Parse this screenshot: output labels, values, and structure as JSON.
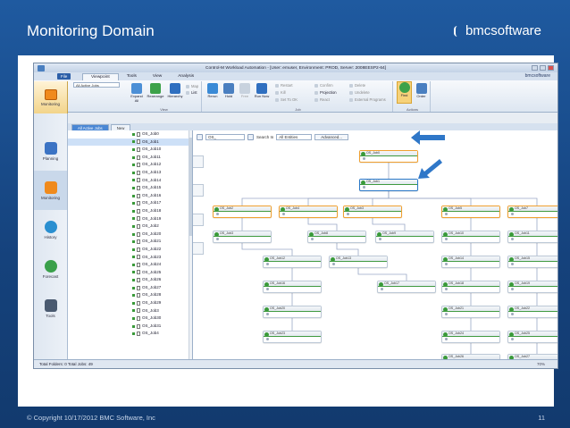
{
  "slide": {
    "title": "Monitoring Domain",
    "logo_text": "bmcsoftware",
    "footer": "© Copyright 10/17/2012 BMC Software, Inc",
    "page_number": "11"
  },
  "app": {
    "window_title": "Control-M Workload Automation - [User: emuser, Environment: PROD, Server: 2008EESP2-64]",
    "file_label": "File",
    "tabs": [
      "Viewpoint",
      "Tools",
      "View",
      "Analysis"
    ],
    "active_tab": "Viewpoint",
    "logo": "bmcsoftware",
    "ribbon": {
      "viewpoint_select": "All Active Jobs",
      "view_group": {
        "expand_all": "Expand All",
        "rearrange": "Rearrange",
        "hierarchy": "Hierarchy",
        "map": "Map",
        "list": "List",
        "label": "View"
      },
      "job_group": {
        "rerun": "Rerun",
        "hold": "Hold",
        "free": "Free",
        "run_now": "Run Now",
        "restart": "Restart",
        "kill": "Kill",
        "set_to_ok": "Set To OK",
        "confirm": "Confirm",
        "projection": "Projection",
        "react": "React",
        "delete": "Delete",
        "undelete": "Undelete",
        "external_programs": "External Programs",
        "label": "Job"
      },
      "actions_group": {
        "find": "Find",
        "order": "Order",
        "label": "Actions"
      }
    },
    "sidenav": [
      {
        "label": "Monitoring"
      },
      {
        "label": "Planning"
      },
      {
        "label": "Monitoring"
      },
      {
        "label": "History"
      },
      {
        "label": "Forecast"
      },
      {
        "label": "Tools"
      }
    ],
    "doc_tabs": [
      "All Active Jobs",
      "New"
    ],
    "tree_items": [
      "OS_Job0",
      "OS_Job1",
      "OS_Job10",
      "OS_Job11",
      "OS_Job12",
      "OS_Job13",
      "OS_Job14",
      "OS_Job15",
      "OS_Job16",
      "OS_Job17",
      "OS_Job18",
      "OS_Job19",
      "OS_Job2",
      "OS_Job20",
      "OS_Job21",
      "OS_Job22",
      "OS_Job23",
      "OS_Job24",
      "OS_Job25",
      "OS_Job26",
      "OS_Job27",
      "OS_Job28",
      "OS_Job29",
      "OS_Job3",
      "OS_Job30",
      "OS_Job31",
      "OS_Job4"
    ],
    "selected_tree_item": "OS_Job1",
    "search": {
      "value": "OS_",
      "search_in_label": "Search In",
      "search_in_value": "All Entities",
      "advanced_button": "Advanced..."
    },
    "status": {
      "left": "Total Folders: 0    Total Jobs: 49",
      "zoom": "70%"
    },
    "graph_nodes": [
      {
        "id": "n1",
        "label": "OS_Job0",
        "style": "orange"
      },
      {
        "id": "n2",
        "label": "OS_Job1",
        "style": "blue"
      },
      {
        "id": "n3",
        "label": "OS_Job2",
        "style": "orange"
      },
      {
        "id": "n4",
        "label": "OS_Job4",
        "style": "orange"
      },
      {
        "id": "n5",
        "label": "OS_Job3",
        "style": "orange"
      },
      {
        "id": "n6",
        "label": "OS_Job5",
        "style": "orange"
      },
      {
        "id": "n7",
        "label": "OS_Job7",
        "style": "orange"
      },
      {
        "id": "n8",
        "label": "OS_Job3",
        "style": "plain"
      },
      {
        "id": "n9",
        "label": "OS_Job8",
        "style": "plain"
      },
      {
        "id": "n10",
        "label": "OS_Job9",
        "style": "plain"
      },
      {
        "id": "n11",
        "label": "OS_Job10",
        "style": "plain"
      },
      {
        "id": "n12",
        "label": "OS_Job11",
        "style": "plain"
      },
      {
        "id": "n13",
        "label": "OS_Job12",
        "style": "plain"
      },
      {
        "id": "n14",
        "label": "OS_Job13",
        "style": "plain"
      },
      {
        "id": "n15",
        "label": "OS_Job14",
        "style": "plain"
      },
      {
        "id": "n16",
        "label": "OS_Job15",
        "style": "plain"
      },
      {
        "id": "n17",
        "label": "OS_Job16",
        "style": "plain"
      },
      {
        "id": "n18",
        "label": "OS_Job17",
        "style": "plain"
      },
      {
        "id": "n19",
        "label": "OS_Job18",
        "style": "plain"
      },
      {
        "id": "n20",
        "label": "OS_Job19",
        "style": "plain"
      },
      {
        "id": "n21",
        "label": "OS_Job20",
        "style": "plain"
      },
      {
        "id": "n22",
        "label": "OS_Job21",
        "style": "plain"
      },
      {
        "id": "n23",
        "label": "OS_Job22",
        "style": "plain"
      },
      {
        "id": "n24",
        "label": "OS_Job23",
        "style": "plain"
      },
      {
        "id": "n25",
        "label": "OS_Job24",
        "style": "plain"
      },
      {
        "id": "n26",
        "label": "OS_Job25",
        "style": "plain"
      },
      {
        "id": "n27",
        "label": "OS_Job26",
        "style": "plain"
      },
      {
        "id": "n28",
        "label": "OS_Job27",
        "style": "plain"
      },
      {
        "id": "n29",
        "label": "OS_Job28",
        "style": "plain"
      },
      {
        "id": "n30",
        "label": "OS_Job29",
        "style": "plain"
      },
      {
        "id": "n31",
        "label": "OS_Job30",
        "style": "plain"
      },
      {
        "id": "n32",
        "label": "OS_Job31",
        "style": "plain"
      }
    ],
    "colors": {
      "slide_bg": "#1a4a8a",
      "ok_green": "#3a9a3a",
      "highlight_orange": "#f0a030",
      "selected_blue": "#2a78c8",
      "callout_arrow": "#2f77c8"
    }
  }
}
